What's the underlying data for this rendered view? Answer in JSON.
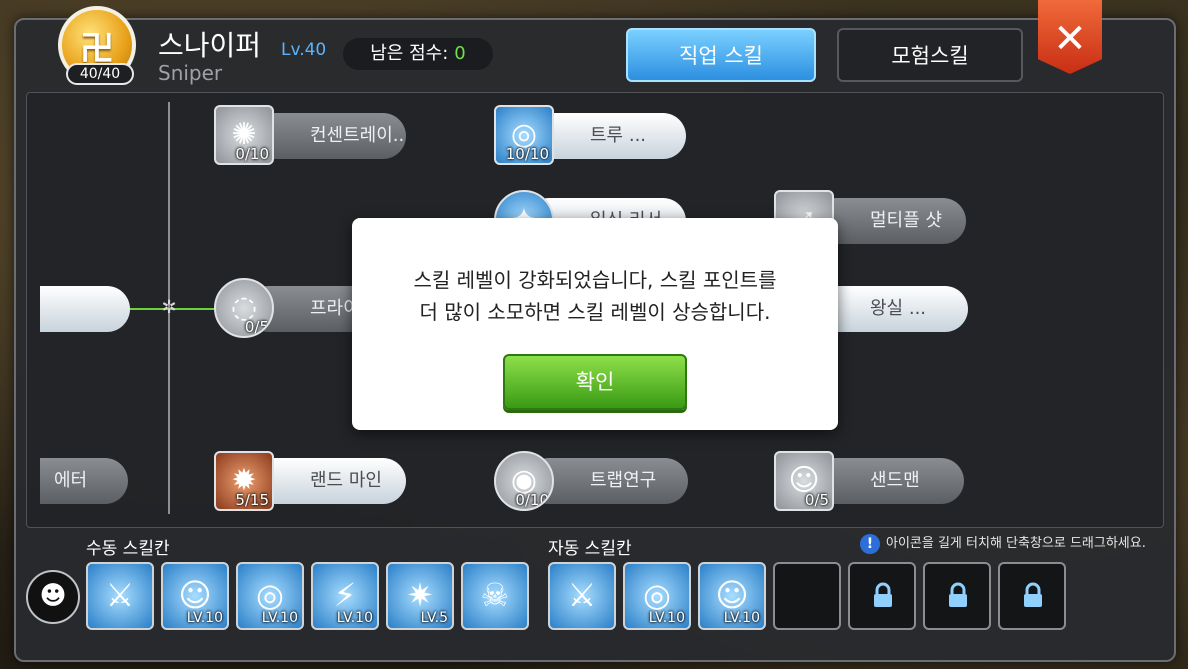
{
  "header": {
    "job_emblem_glyph": "卍",
    "emblem_count": "40/40",
    "class_name": "스나이퍼",
    "class_level": "Lv.40",
    "class_name_en": "Sniper",
    "points_label": "남은 점수:",
    "points_value": "0",
    "tabs": {
      "job": "직업 스킬",
      "adventure": "모험스킬"
    },
    "close_glyph": "✕"
  },
  "tree": {
    "axis_node_glyph": "✲",
    "skills": [
      {
        "label": "컨센트레이...",
        "level": "0/10",
        "glyph": "✺"
      },
      {
        "label": "트루 ...",
        "level": "10/10",
        "glyph": "◎"
      },
      {
        "label": "멀티플 샷",
        "level": "",
        "glyph": "➶"
      },
      {
        "label": "프라이톤",
        "level": "0/5",
        "glyph": "◌"
      },
      {
        "label": "왕실 ...",
        "level": "",
        "glyph": ""
      },
      {
        "label": "랜드 마인",
        "level": "5/15",
        "glyph": "✹"
      },
      {
        "label": "트랩연구",
        "level": "0/10",
        "glyph": "◉"
      },
      {
        "label": "샌드맨",
        "level": "0/5",
        "glyph": "☺"
      },
      {
        "label": "에터",
        "level": "",
        "glyph": ""
      },
      {
        "label": "일싯 리서",
        "level": "",
        "glyph": "✦"
      }
    ]
  },
  "modal": {
    "line1": "스킬 레벨이 강화되었습니다, 스킬 포인트를",
    "line2": "더 많이 소모하면 스킬 레벨이 상승합니다.",
    "confirm": "확인"
  },
  "slots": {
    "manual_label": "수동 스킬칸",
    "auto_label": "자동 스킬칸",
    "hint_icon": "!",
    "hint": "아이콘을 길게 터치해 단축창으로 드래그하세요.",
    "emote_glyph": "☻",
    "manual": [
      {
        "glyph": "⚔",
        "level": ""
      },
      {
        "glyph": "☺",
        "level": "LV.10"
      },
      {
        "glyph": "◎",
        "level": "LV.10"
      },
      {
        "glyph": "⚡",
        "level": "LV.10"
      },
      {
        "glyph": "✷",
        "level": "LV.5"
      },
      {
        "glyph": "☠",
        "level": ""
      }
    ],
    "auto": [
      {
        "glyph": "⚔",
        "level": ""
      },
      {
        "glyph": "◎",
        "level": "LV.10"
      },
      {
        "glyph": "☺",
        "level": "LV.10"
      }
    ]
  }
}
